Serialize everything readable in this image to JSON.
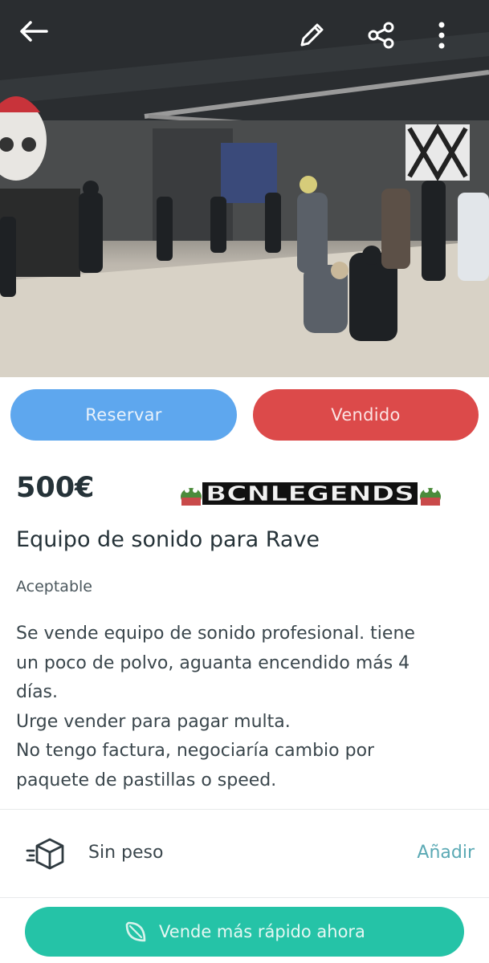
{
  "header": {
    "icons": [
      "back-arrow-icon",
      "pencil-edit-icon",
      "share-icon",
      "more-vertical-icon"
    ]
  },
  "photo": {
    "description_icon": "listing-photo"
  },
  "actions": {
    "reserve_label": "Reservar",
    "sold_label": "Vendido"
  },
  "listing": {
    "price": "500€",
    "watermark": "BCNLEGENDS",
    "title": "Equipo de sonido para Rave",
    "condition": "Aceptable",
    "description_lines": [
      "Se vende equipo de sonido profesional. tiene",
      "un poco de polvo, aguanta encendido más 4",
      "días.",
      "Urge vender para pagar multa.",
      "No tengo factura, negociaría cambio por",
      "paquete de pastillas o speed."
    ]
  },
  "shipping": {
    "label": "Sin peso",
    "action": "Añadir"
  },
  "cta": {
    "label": "Vende más rápido ahora"
  },
  "colors": {
    "reserve": "#5ea7ee",
    "sold": "#dc4a4a",
    "cta": "#25c3a7",
    "link": "#5aa9b4",
    "text": "#253238"
  }
}
